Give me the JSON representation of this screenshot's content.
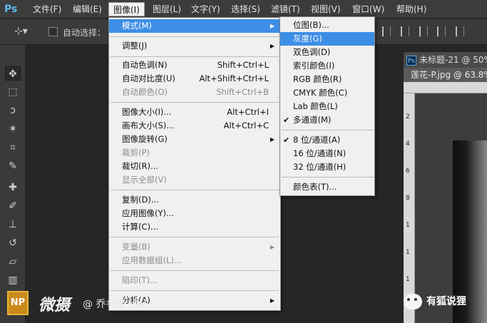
{
  "app": {
    "logo": "Ps"
  },
  "menubar": {
    "items": [
      "文件(F)",
      "编辑(E)",
      "图像(I)",
      "图层(L)",
      "文字(Y)",
      "选择(S)",
      "滤镜(T)",
      "视图(V)",
      "窗口(W)",
      "帮助(H)"
    ],
    "active_index": 2
  },
  "options": {
    "auto_select_label": "自动选择："
  },
  "document": {
    "tab1_label": "未标题-21 @ 50%",
    "tab1_icon": "Ps",
    "tab2_label": "莲花-P.jpg @ 63.8%",
    "ruler_marks": [
      "2",
      "4",
      "6",
      "8",
      "1",
      "1",
      "1",
      "1",
      "1",
      "2"
    ]
  },
  "image_menu": {
    "items": [
      {
        "label": "模式(M)",
        "shortcut": "",
        "submenu": true,
        "highlighted": true,
        "disabled": false
      },
      {
        "label": "调整(J)",
        "shortcut": "",
        "submenu": true,
        "disabled": false
      },
      {
        "label": "自动色调(N)",
        "shortcut": "Shift+Ctrl+L",
        "disabled": false
      },
      {
        "label": "自动对比度(U)",
        "shortcut": "Alt+Shift+Ctrl+L",
        "disabled": false
      },
      {
        "label": "自动颜色(O)",
        "shortcut": "Shift+Ctrl+B",
        "disabled": true
      },
      {
        "label": "图像大小(I)...",
        "shortcut": "Alt+Ctrl+I",
        "disabled": false
      },
      {
        "label": "画布大小(S)...",
        "shortcut": "Alt+Ctrl+C",
        "disabled": false
      },
      {
        "label": "图像旋转(G)",
        "shortcut": "",
        "submenu": true,
        "disabled": false
      },
      {
        "label": "裁剪(P)",
        "shortcut": "",
        "disabled": true
      },
      {
        "label": "裁切(R)...",
        "shortcut": "",
        "disabled": false
      },
      {
        "label": "显示全部(V)",
        "shortcut": "",
        "disabled": true
      },
      {
        "label": "复制(D)...",
        "shortcut": "",
        "disabled": false
      },
      {
        "label": "应用图像(Y)...",
        "shortcut": "",
        "disabled": false
      },
      {
        "label": "计算(C)...",
        "shortcut": "",
        "disabled": false
      },
      {
        "label": "变量(B)",
        "shortcut": "",
        "submenu": true,
        "disabled": true
      },
      {
        "label": "应用数据组(L)...",
        "shortcut": "",
        "disabled": true
      },
      {
        "label": "陷印(T)...",
        "shortcut": "",
        "disabled": true
      },
      {
        "label": "分析(A)",
        "shortcut": "",
        "submenu": true,
        "disabled": false
      }
    ]
  },
  "mode_submenu": {
    "items": [
      {
        "label": "位图(B)...",
        "checked": false,
        "highlighted": false
      },
      {
        "label": "灰度(G)",
        "checked": false,
        "highlighted": true
      },
      {
        "label": "双色调(D)",
        "checked": false,
        "highlighted": false
      },
      {
        "label": "索引颜色(I)",
        "checked": false,
        "highlighted": false
      },
      {
        "label": "RGB 颜色(R)",
        "checked": false,
        "highlighted": false
      },
      {
        "label": "CMYK 颜色(C)",
        "checked": false,
        "highlighted": false
      },
      {
        "label": "Lab 颜色(L)",
        "checked": false,
        "highlighted": false
      },
      {
        "label": "多通道(M)",
        "checked": true,
        "highlighted": false
      },
      {
        "label": "8 位/通道(A)",
        "checked": true,
        "highlighted": false
      },
      {
        "label": "16 位/通道(N)",
        "checked": false,
        "highlighted": false
      },
      {
        "label": "32 位/通道(H)",
        "checked": false,
        "highlighted": false
      },
      {
        "label": "颜色表(T)...",
        "checked": false,
        "highlighted": false
      }
    ],
    "check_glyph": "✔"
  },
  "watermark": {
    "logo_text": "NP",
    "brand": "微摄",
    "author": "@ 乔冬娟 [微]",
    "right_text": "有狐说狸"
  },
  "colors": {
    "highlight": "#3d8ee6",
    "menubar": "#3c3c3c"
  }
}
